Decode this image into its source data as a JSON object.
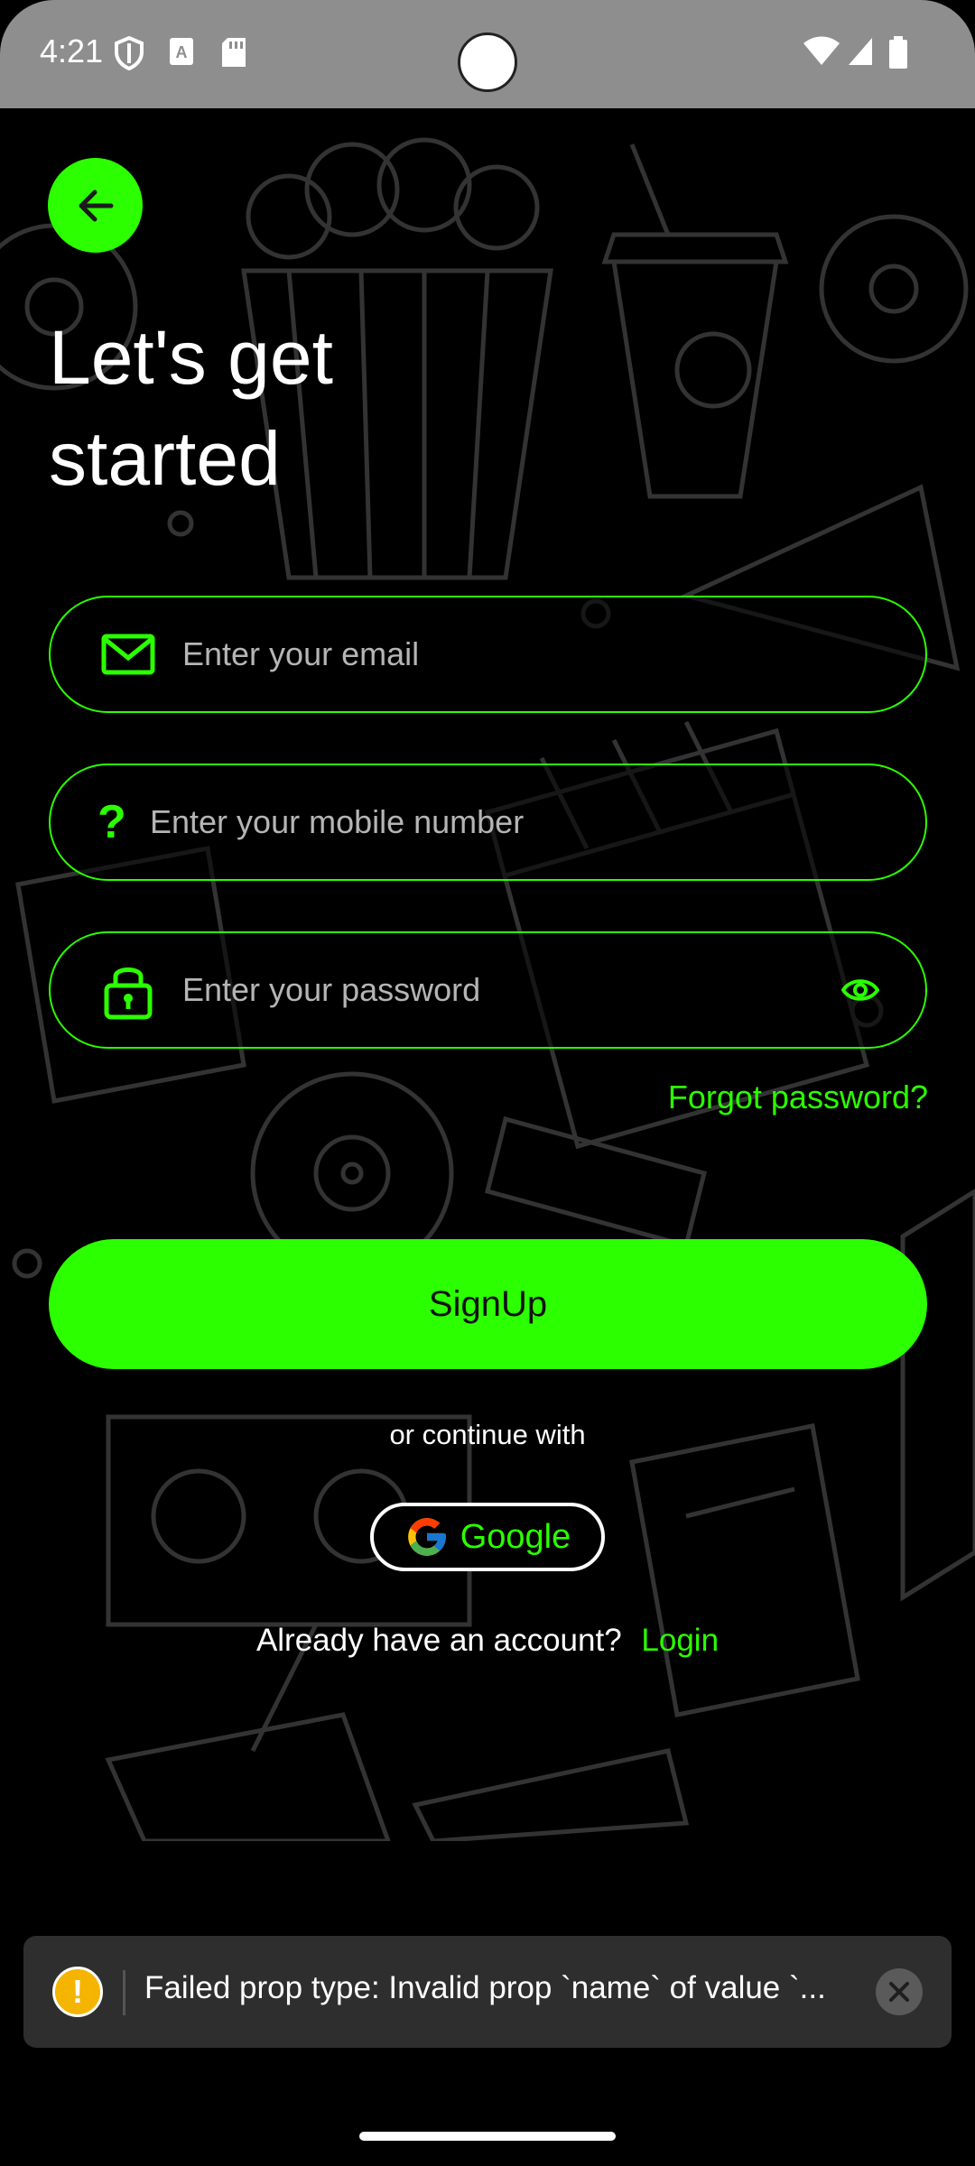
{
  "status_bar": {
    "time": "4:21"
  },
  "title": {
    "line1": "Let's get",
    "line2": "started"
  },
  "form": {
    "email_placeholder": "Enter your email",
    "mobile_placeholder": "Enter your mobile number",
    "password_placeholder": "Enter your password",
    "mobile_icon_glyph": "?"
  },
  "forgot_password": "Forgot password?",
  "signup_button": "SignUp",
  "or_continue": "or continue with",
  "google_button": "Google",
  "login_prompt": {
    "question": "Already have an account?",
    "link": "Login"
  },
  "toast": {
    "message": "Failed prop type: Invalid prop `name` of value `..."
  },
  "colors": {
    "accent": "#2bff00",
    "background": "#000000",
    "status_bar": "#8e8e8e",
    "toast_bg": "#2e2e2e",
    "warning": "#f5b400"
  }
}
